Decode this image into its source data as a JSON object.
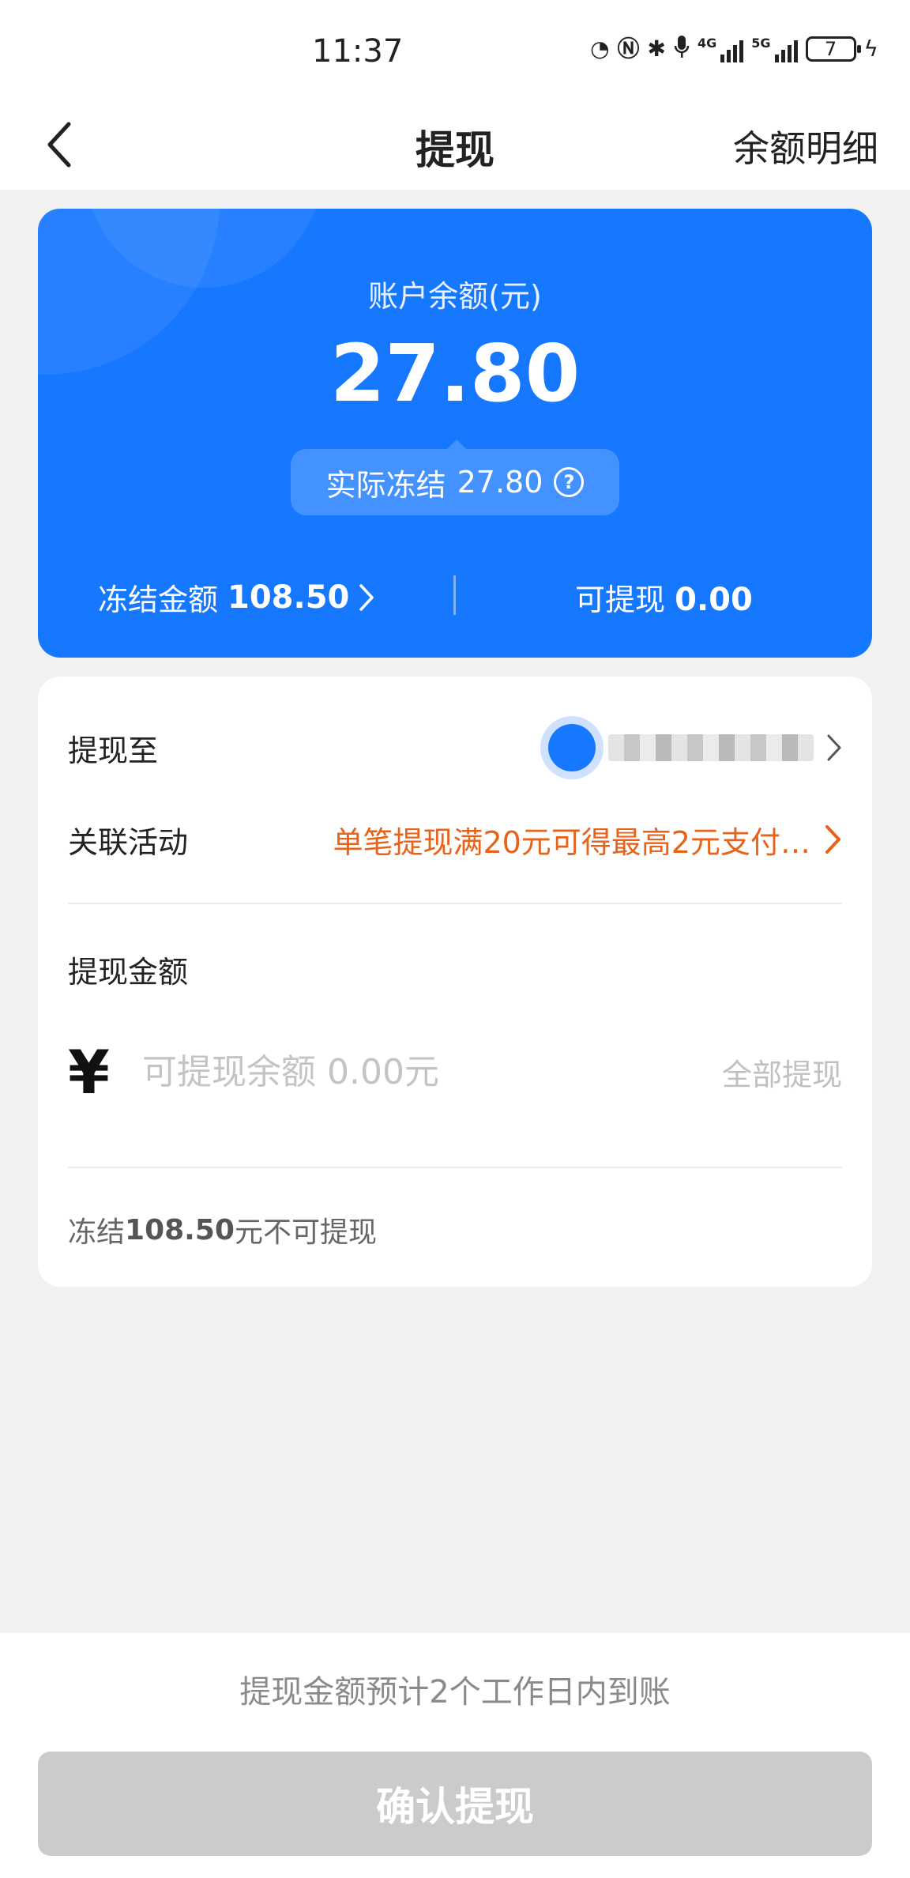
{
  "status_bar": {
    "time": "11:37",
    "network_4g": "4G",
    "network_5g": "5G",
    "battery": "7"
  },
  "nav": {
    "title": "提现",
    "balance_detail": "余额明细"
  },
  "balance_card": {
    "label": "账户余额(元)",
    "amount": "27.80",
    "actual_frozen_label": "实际冻结",
    "actual_frozen_value": "27.80",
    "frozen_label": "冻结金额",
    "frozen_value": "108.50",
    "withdrawable_label": "可提现",
    "withdrawable_value": "0.00",
    "color": "#1677ff"
  },
  "form": {
    "withdraw_to_label": "提现至",
    "activity_label": "关联活动",
    "activity_text": "单笔提现满20元可得最高2元支付…",
    "activity_color": "#e8621a",
    "amount_label": "提现金额",
    "currency_symbol": "¥",
    "amount_placeholder": "可提现余额 0.00元",
    "withdraw_all": "全部提现",
    "frozen_note_prefix": "冻结",
    "frozen_note_amount": "108.50",
    "frozen_note_suffix": "元不可提现"
  },
  "bottom": {
    "arrival_note": "提现金额预计2个工作日内到账",
    "confirm_button": "确认提现"
  }
}
